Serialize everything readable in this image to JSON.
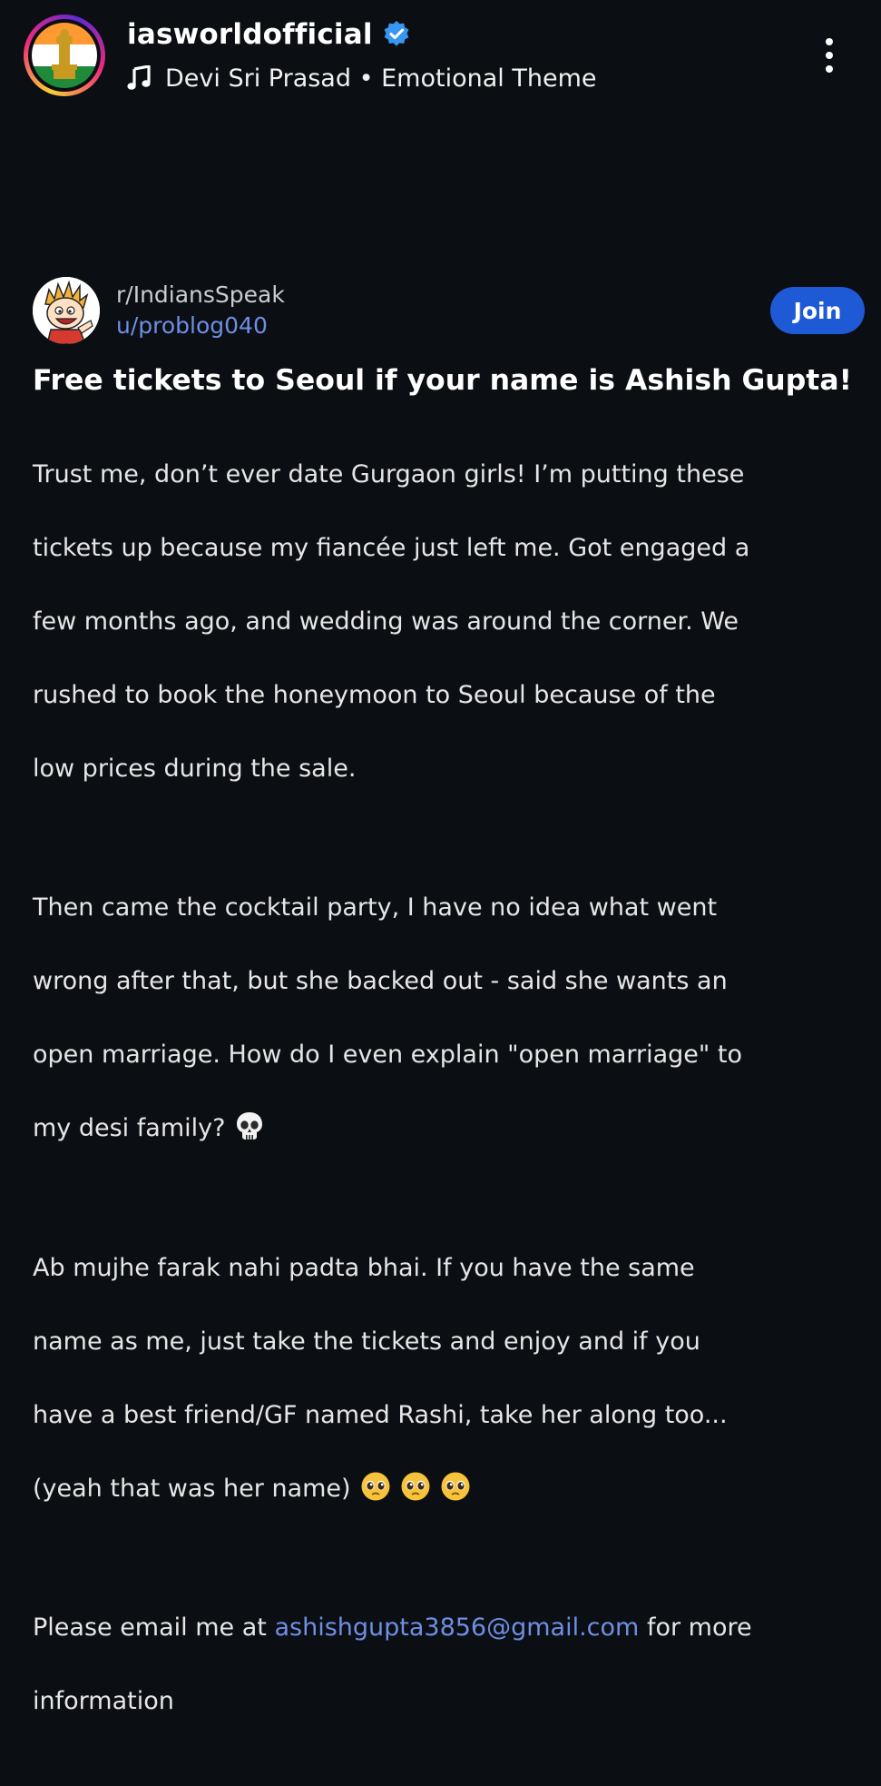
{
  "reel": {
    "username": "iasworldofficial",
    "audio_artist": "Devi Sri Prasad",
    "audio_separator": "•",
    "audio_track": "Emotional Theme",
    "icons": {
      "verified": "verified-badge-icon",
      "music": "music-note-icon",
      "more": "more-options-icon"
    },
    "colors": {
      "verified": "#3897f0",
      "background": "#0b0e13"
    }
  },
  "post": {
    "subreddit": "r/IndiansSpeak",
    "user": "u/problog040",
    "join_label": "Join",
    "title": "Free tickets to Seoul if your name is Ashish Gupta!",
    "paragraphs": [
      {
        "lines": [
          "Trust me, don’t ever date Gurgaon girls! I’m putting these",
          "tickets up because my fiancée just left me. Got engaged a",
          "few months ago, and wedding was around the corner. We",
          "rushed to book the honeymoon to Seoul because of the",
          "low prices during the sale."
        ]
      },
      {
        "lines": [
          "Then came the cocktail party, I have no idea what went",
          "wrong after that, but she backed out - said she wants an",
          "open marriage. How do I even explain \"open marriage\" to",
          "my desi family?"
        ],
        "trailing_emoji": [
          "skull-emoji"
        ]
      },
      {
        "lines": [
          "Ab mujhe farak nahi padta bhai. If you have the same",
          "name as me, just take the tickets and enjoy and if you",
          "have a best friend/GF named Rashi, take her along too...",
          "(yeah that was her name)"
        ],
        "trailing_emoji": [
          "pleading-face-emoji",
          "pleading-face-emoji",
          "pleading-face-emoji"
        ]
      }
    ],
    "email_prefix": "Please email me at ",
    "email": "ashishgupta3856@gmail.com",
    "email_suffix": " for more",
    "email_last_line": "information",
    "colors": {
      "link": "#6f8fe3",
      "join_button": "#1f5ad6"
    }
  }
}
